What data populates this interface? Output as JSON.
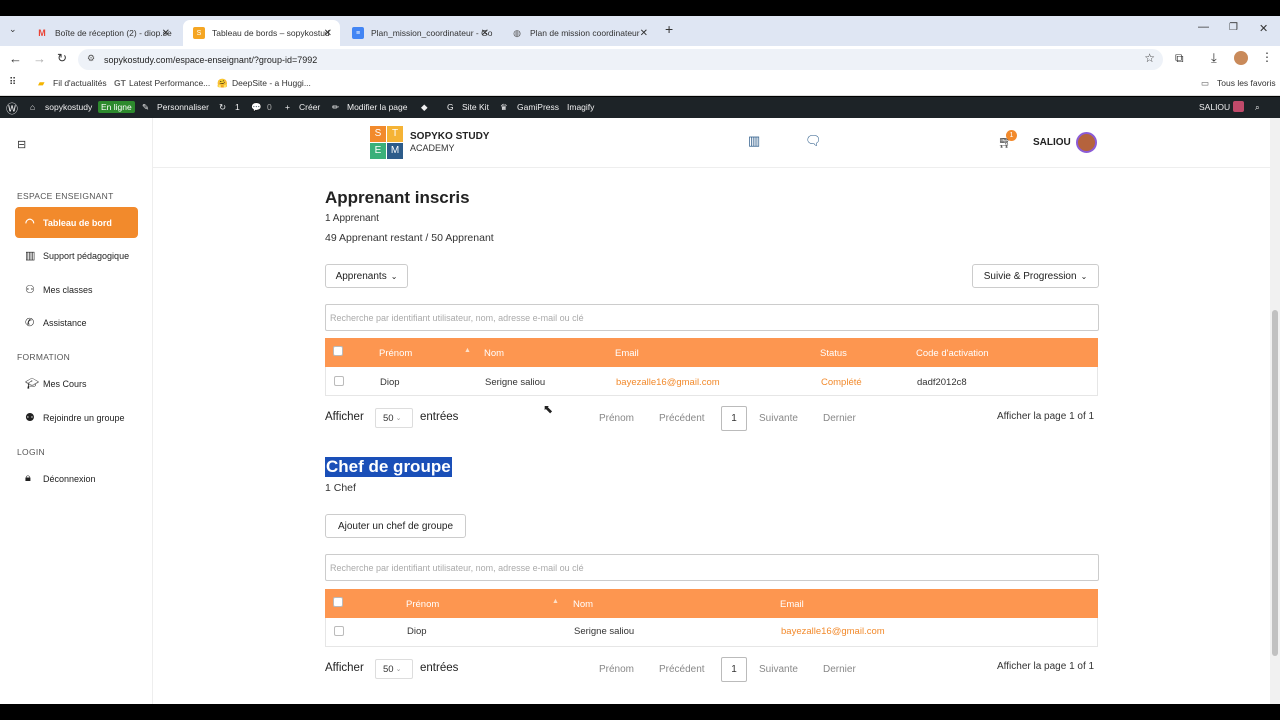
{
  "browser": {
    "tabs": [
      {
        "label": "Boîte de réception (2) - diop.se",
        "active": false
      },
      {
        "label": "Tableau de bords – sopykostud",
        "active": true
      },
      {
        "label": "Plan_mission_coordinateur - Go",
        "active": false
      },
      {
        "label": "Plan de mission coordinateur",
        "active": false
      }
    ],
    "url": "sopykostudy.com/espace-enseignant/?group-id=7992",
    "bookmarks": [
      "Fil d'actualités",
      "Latest Performance...",
      "DeepSite - a Huggi..."
    ],
    "all_bookmarks": "Tous les favoris"
  },
  "wpbar": {
    "site": "sopykostudy",
    "status": "En ligne",
    "customize": "Personnaliser",
    "updates": "1",
    "comments": "0",
    "create": "Créer",
    "edit_page": "Modifier la page",
    "site_kit": "Site Kit",
    "gamipress": "GamiPress",
    "imagify": "Imagify",
    "user": "SALIOU"
  },
  "sidebar": {
    "sections": [
      {
        "title": "ESPACE ENSEIGNANT",
        "items": [
          {
            "label": "Tableau de bord",
            "active": true,
            "icon": "dashboard-icon"
          },
          {
            "label": "Support pédagogique",
            "active": false,
            "icon": "books-icon"
          },
          {
            "label": "Mes classes",
            "active": false,
            "icon": "users-icon"
          },
          {
            "label": "Assistance",
            "active": false,
            "icon": "phone-icon"
          }
        ]
      },
      {
        "title": "FORMATION",
        "items": [
          {
            "label": "Mes Cours",
            "active": false,
            "icon": "graduation-icon"
          },
          {
            "label": "Rejoindre un groupe",
            "active": false,
            "icon": "group-icon"
          }
        ]
      },
      {
        "title": "LOGIN",
        "items": [
          {
            "label": "Déconnexion",
            "active": false,
            "icon": "lock-icon"
          }
        ]
      }
    ]
  },
  "header": {
    "brand_line1": "SOPYKO STUDY",
    "brand_line2": "ACADEMY",
    "logo_letters": [
      "S",
      "T",
      "E",
      "M"
    ],
    "cart_count": "1",
    "user": "SALIOU"
  },
  "learners": {
    "title": "Apprenant inscris",
    "count": "1 Apprenant",
    "remaining": "49 Apprenant restant / 50 Apprenant",
    "dropdown_left": "Apprenants",
    "dropdown_right": "Suivie & Progression",
    "search_placeholder": "Recherche par identifiant utilisateur, nom, adresse e-mail ou clé",
    "columns": [
      "Prénom",
      "Nom",
      "Email",
      "Status",
      "Code d'activation"
    ],
    "rows": [
      {
        "prenom": "Diop",
        "nom": "Serigne saliou",
        "email": "bayezalle16@gmail.com",
        "status": "Complété",
        "code": "dadf2012c8"
      }
    ],
    "show": "Afficher",
    "per_page": "50",
    "entries": "entrées",
    "pager": {
      "first": "Prénom",
      "prev": "Précédent",
      "page": "1",
      "next": "Suivante",
      "last": "Dernier",
      "info": "Afficher la page 1 of 1"
    }
  },
  "leaders": {
    "title": "Chef de groupe",
    "count": "1 Chef",
    "add_button": "Ajouter un chef de groupe",
    "search_placeholder": "Recherche par identifiant utilisateur, nom, adresse e-mail ou clé",
    "columns": [
      "Prénom",
      "Nom",
      "Email"
    ],
    "rows": [
      {
        "prenom": "Diop",
        "nom": "Serigne saliou",
        "email": "bayezalle16@gmail.com"
      }
    ],
    "show": "Afficher",
    "per_page": "50",
    "entries": "entrées",
    "pager": {
      "first": "Prénom",
      "prev": "Précédent",
      "page": "1",
      "next": "Suivante",
      "last": "Dernier",
      "info": "Afficher la page 1 of 1"
    }
  },
  "colors": {
    "accent": "#f28a2c",
    "table_header": "#fd9650",
    "selection": "#1a4fb8"
  }
}
